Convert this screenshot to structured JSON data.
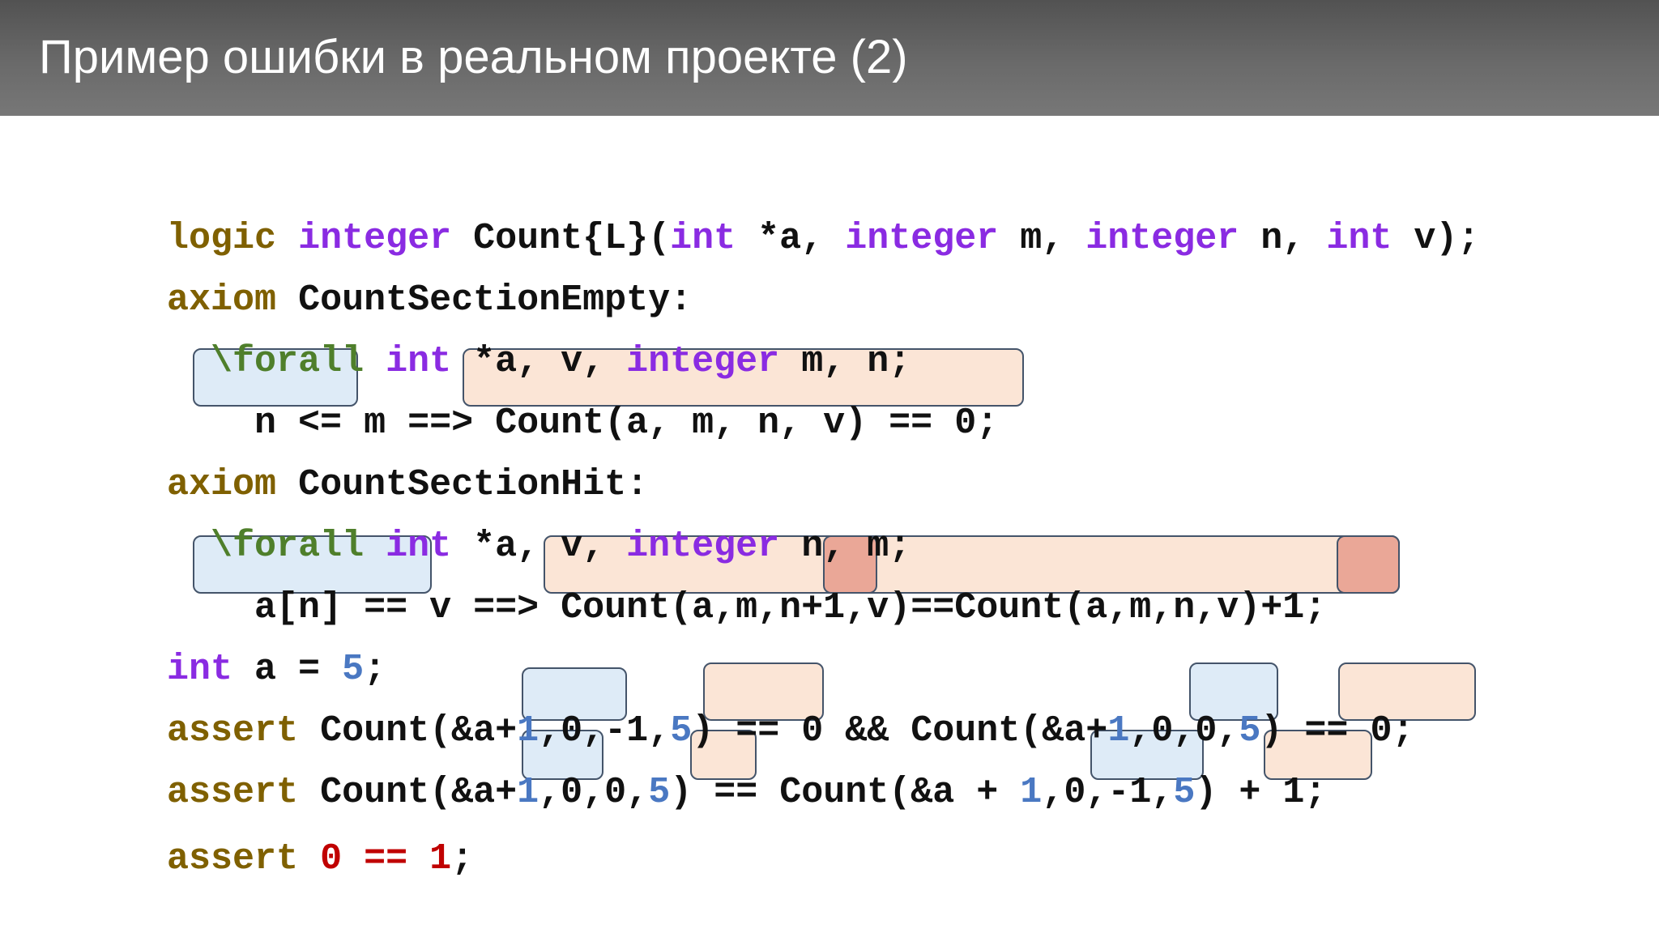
{
  "header": {
    "title": "Пример ошибки в реальном проекте (2)"
  },
  "code": {
    "line1": {
      "t1": "logic",
      "t2": " ",
      "t3": "integer",
      "t4": " Count{L}(",
      "t5": "int",
      "t6": " *a, ",
      "t7": "integer",
      "t8": " m, ",
      "t9": "integer",
      "t10": " n, ",
      "t11": "int",
      "t12": " v);"
    },
    "line2": {
      "t1": "axiom",
      "t2": " CountSectionEmpty:"
    },
    "line3": {
      "t1": "  ",
      "t2": "\\forall",
      "t3": " ",
      "t4": "int",
      "t5": " *a, v, ",
      "t6": "integer",
      "t7": " m, n;"
    },
    "line4": {
      "t1": "    n <= m ==> Count(a, m, n, v) == 0;"
    },
    "line5": {
      "t1": "axiom",
      "t2": " CountSectionHit:"
    },
    "line6": {
      "t1": "  ",
      "t2": "\\forall",
      "t3": " ",
      "t4": "int",
      "t5": " *a, v, ",
      "t6": "integer",
      "t7": " n, m;"
    },
    "line7": {
      "t1": "    a[n] == v ==> Count(a,m,n",
      "t2": "+1",
      "t3": ",v)==Count(a,m,n,v)",
      "t4": "+1",
      "t5": ";"
    },
    "line8": {
      "t1": "int",
      "t2": " a = ",
      "t3": "5",
      "t4": ";"
    },
    "line9": {
      "t1": "assert",
      "t2": " Count(&a+",
      "t3": "1",
      "t4": ",",
      "t5": "0",
      "t6": ",",
      "t7": "-1",
      "t8": ",",
      "t9": "5",
      "t10": ") == 0 && Count(&a+",
      "t11": "1",
      "t12": ",",
      "t13": "0",
      "t14": ",",
      "t15": "0",
      "t16": ",",
      "t17": "5",
      "t18": ") == 0;"
    },
    "line10": {
      "t1": "assert",
      "t2": " Count(&a+",
      "t3": "1",
      "t4": ",",
      "t5": "0",
      "t6": ",",
      "t7": "0",
      "t8": ",",
      "t9": "5",
      "t10": ") == Count(&a + ",
      "t11": "1",
      "t12": ",",
      "t13": "0",
      "t14": ",",
      "t15": "-1",
      "t16": ",",
      "t17": "5",
      "t18": ") + 1;"
    },
    "line11": {
      "t1": "assert",
      "t2": " ",
      "t3": "0",
      "t4": " ",
      "t5": "==",
      "t6": " ",
      "t7": "1",
      "t8": ";"
    }
  },
  "colors": {
    "header_bg": "#666666",
    "keyword_brown": "#7f6000",
    "keyword_purple": "#8a2be2",
    "keyword_green": "#4f7f2b",
    "number_blue": "#4a78c2",
    "false_red": "#c00000",
    "highlight_blue": "#deebf7",
    "highlight_peach": "#fbe5d6",
    "highlight_red": "#eaa797"
  }
}
